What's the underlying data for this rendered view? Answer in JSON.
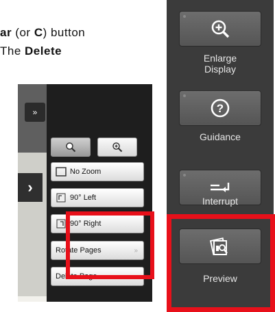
{
  "doc": {
    "line1_bold_start": "ar",
    "line1_mid": " (or ",
    "line1_bold_key": "C",
    "line1_end": ") button",
    "line2_start": "The ",
    "line2_bold": "Delete"
  },
  "left_menu": {
    "toggle_glyph": "»",
    "chevron_glyph": "›",
    "zoom_out_icon": "zoom-out-icon",
    "zoom_in_icon": "zoom-in-icon",
    "items": [
      {
        "label": "No Zoom",
        "icon": "no-zoom-icon"
      },
      {
        "label": "90° Left",
        "icon": "rotate-left-icon"
      },
      {
        "label": "90° Right",
        "icon": "rotate-right-icon"
      },
      {
        "label": "Rotate Pages",
        "more": "»"
      },
      {
        "label": "Delete Page",
        "more": "»"
      }
    ]
  },
  "right_panel": {
    "buttons": [
      {
        "label": "Enlarge Display",
        "icon": "magnify-plus-icon"
      },
      {
        "label": "Guidance",
        "icon": "question-icon"
      },
      {
        "label": "Interrupt",
        "icon": "interrupt-icon"
      },
      {
        "label": "Preview",
        "icon": "preview-icon"
      }
    ]
  },
  "colors": {
    "highlight": "#e8101a",
    "panel_dark": "#3b3b3b",
    "menu_dark": "#1e1e1e"
  }
}
